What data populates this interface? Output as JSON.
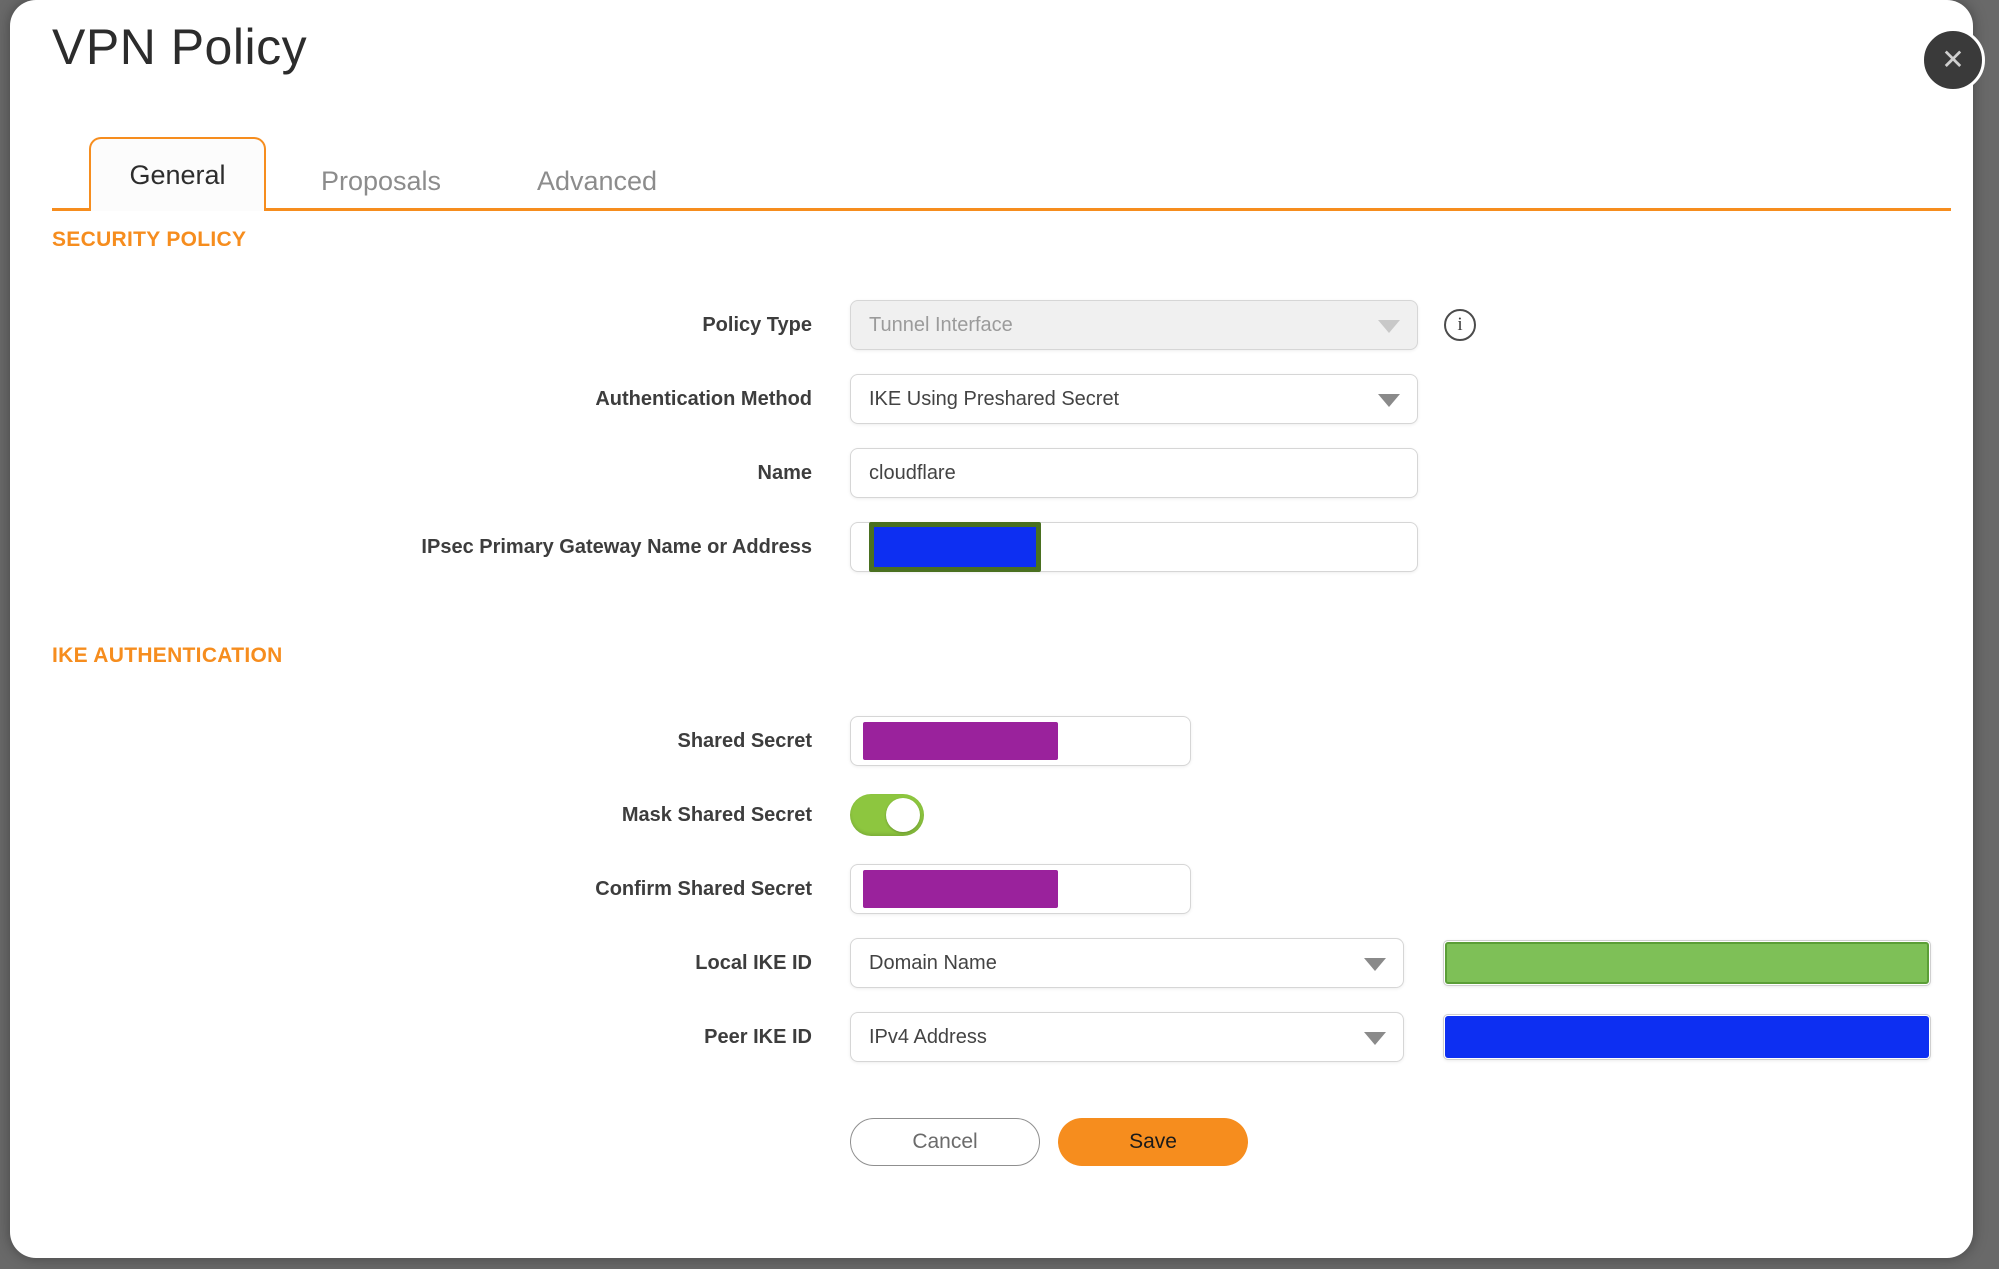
{
  "dialog": {
    "title": "VPN Policy",
    "close_icon": "✕"
  },
  "tabs": [
    {
      "label": "General",
      "active": true
    },
    {
      "label": "Proposals",
      "active": false
    },
    {
      "label": "Advanced",
      "active": false
    }
  ],
  "sections": {
    "security_policy": {
      "title": "SECURITY POLICY",
      "fields": {
        "policy_type": {
          "label": "Policy Type",
          "value": "Tunnel Interface",
          "disabled": true
        },
        "auth_method": {
          "label": "Authentication Method",
          "value": "IKE Using Preshared Secret"
        },
        "name": {
          "label": "Name",
          "value": "cloudflare"
        },
        "gateway": {
          "label": "IPsec Primary Gateway Name or Address",
          "value": "",
          "redacted": true
        }
      }
    },
    "ike_authentication": {
      "title": "IKE AUTHENTICATION",
      "fields": {
        "shared_secret": {
          "label": "Shared Secret",
          "value": "",
          "redacted": true
        },
        "mask_shared_secret": {
          "label": "Mask Shared Secret",
          "enabled": true
        },
        "confirm_shared_secret": {
          "label": "Confirm Shared Secret",
          "value": "",
          "redacted": true
        },
        "local_ike_id": {
          "label": "Local IKE ID",
          "selected": "Domain Name",
          "value_redacted": true
        },
        "peer_ike_id": {
          "label": "Peer IKE ID",
          "selected": "IPv4 Address",
          "value_redacted": true
        }
      }
    }
  },
  "info_icon": "i",
  "actions": {
    "cancel": "Cancel",
    "save": "Save"
  },
  "colors": {
    "accent_orange": "#f68d1e",
    "toggle_green": "#8dc63f",
    "redaction_purple": "#9a229c",
    "redaction_blue": "#0d2ff2",
    "redaction_olive_border": "#4a7020",
    "redaction_green_fill": "#7ec057",
    "redaction_green_border": "#5b9e37"
  }
}
